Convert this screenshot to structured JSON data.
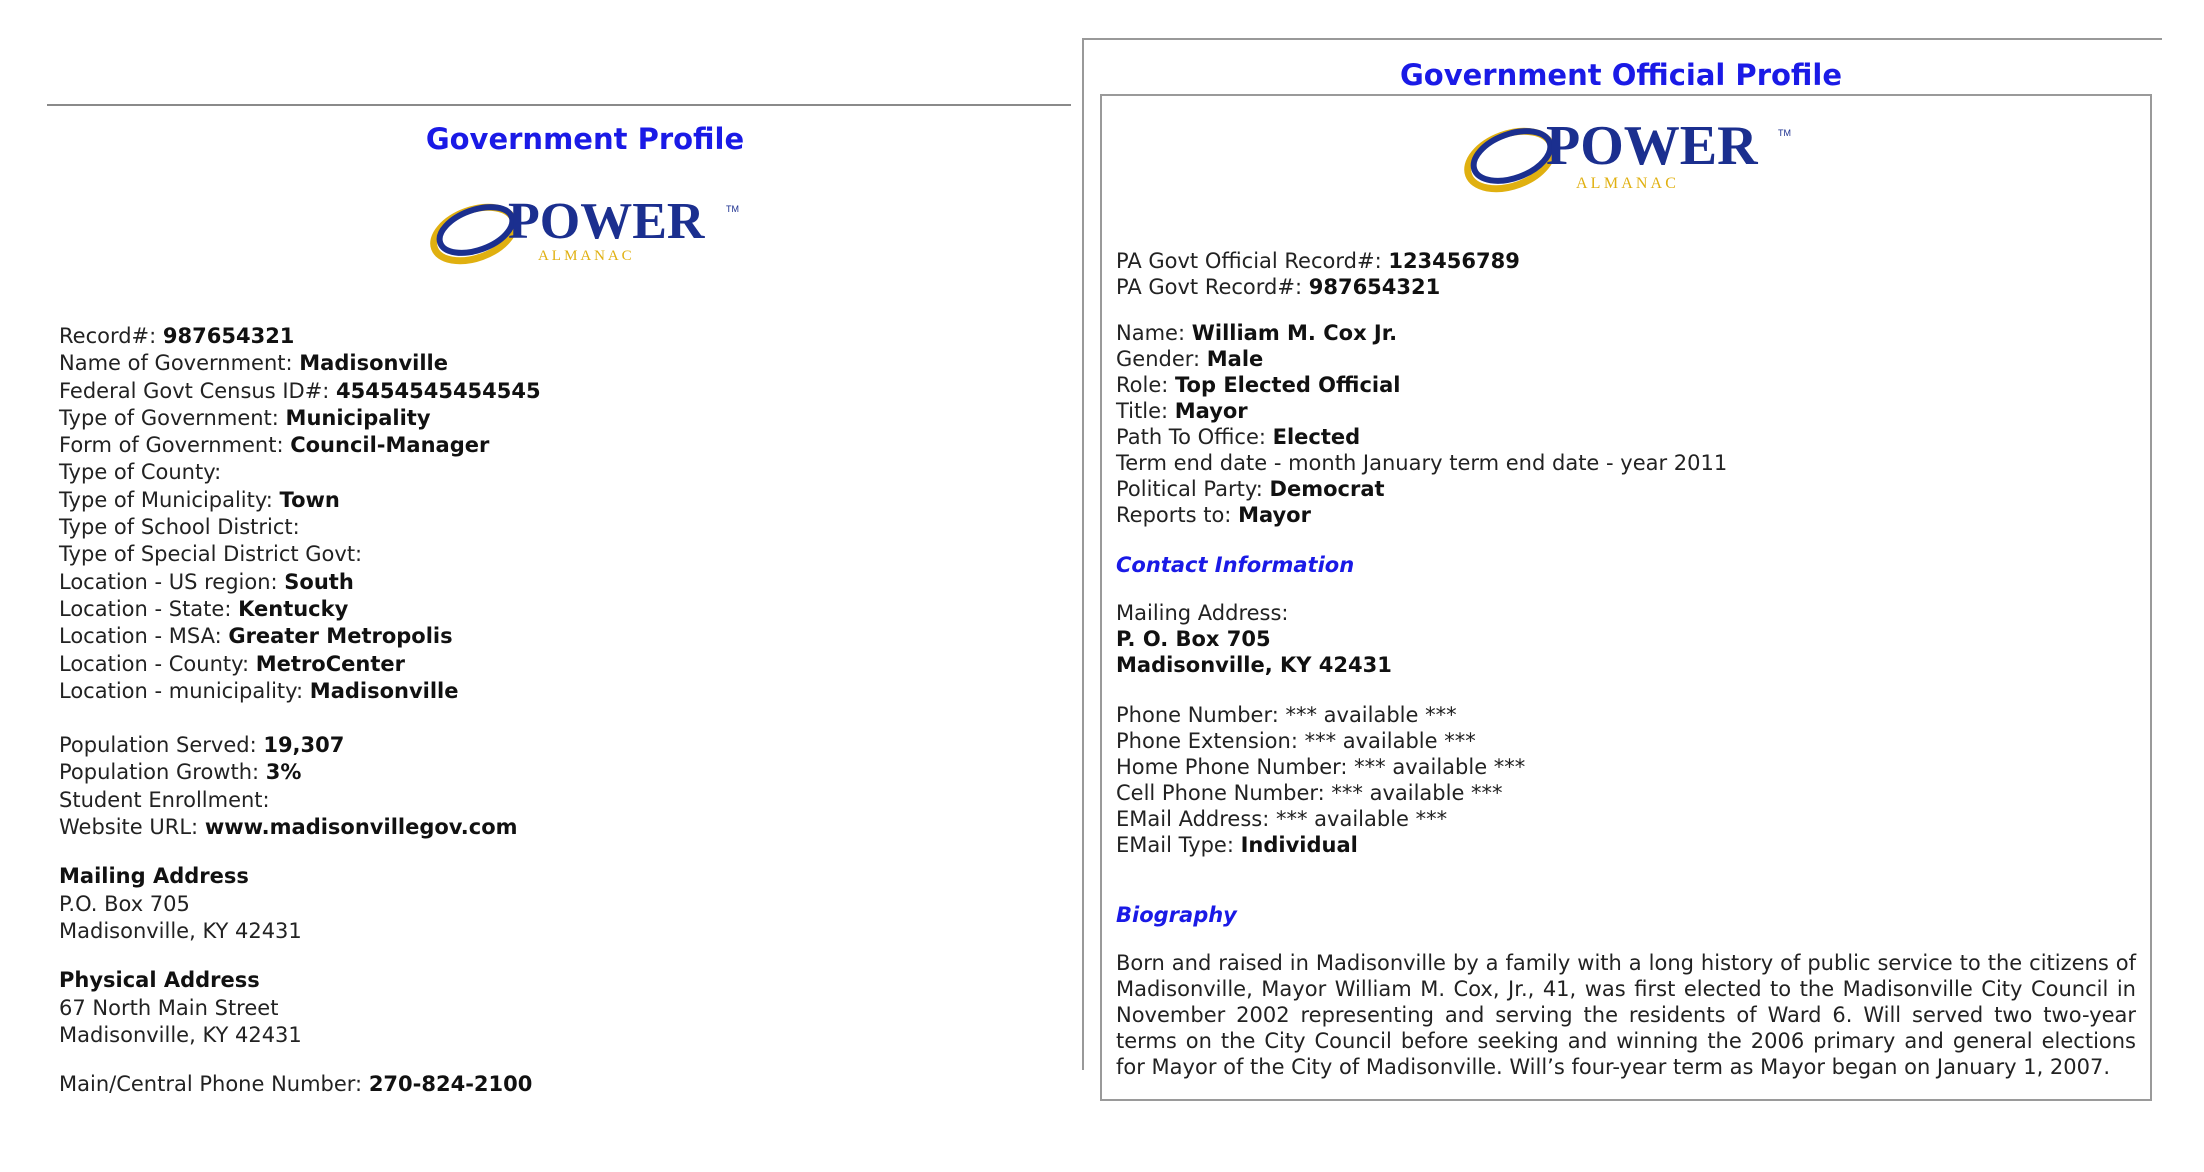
{
  "left": {
    "title": "Government Profile",
    "logo": {
      "word": "POWER",
      "tm": "TM",
      "sub": "A L M A N A C"
    },
    "fields": [
      {
        "label": "Record#: ",
        "value": "987654321"
      },
      {
        "label": "Name of Government: ",
        "value": "Madisonville"
      },
      {
        "label": "Federal Govt Census ID#: ",
        "value": "45454545454545"
      },
      {
        "label": "Type of Government: ",
        "value": "Municipality"
      },
      {
        "label": "Form of Government: ",
        "value": "Council-Manager"
      },
      {
        "label": "Type of County:",
        "value": ""
      },
      {
        "label": "Type of Municipality: ",
        "value": "Town"
      },
      {
        "label": "Type of School District:",
        "value": ""
      },
      {
        "label": "Type of Special District Govt:",
        "value": ""
      },
      {
        "label": "Location - US region: ",
        "value": "South"
      },
      {
        "label": "Location - State: ",
        "value": "Kentucky"
      },
      {
        "label": "Location - MSA: ",
        "value": "Greater Metropolis"
      },
      {
        "label": "Location - County: ",
        "value": "MetroCenter"
      },
      {
        "label": "Location - municipality: ",
        "value": "Madisonville"
      }
    ],
    "fields2": [
      {
        "label": "Population Served: ",
        "value": "19,307"
      },
      {
        "label": "Population Growth: ",
        "value": "3%"
      },
      {
        "label": "Student Enrollment:",
        "value": ""
      },
      {
        "label": "Website URL: ",
        "value": "www.madisonvillegov.com"
      }
    ],
    "mailing": {
      "heading": "Mailing Address",
      "line1": "P.O. Box 705",
      "line2": "Madisonville, KY 42431"
    },
    "physical": {
      "heading": "Physical Address",
      "line1": "67 North Main Street",
      "line2": "Madisonville, KY 42431"
    },
    "phone": {
      "label": "Main/Central Phone Number: ",
      "value": "270-824-2100"
    }
  },
  "right": {
    "title": "Government Official Profile",
    "logo": {
      "word": "POWER",
      "tm": "TM",
      "sub": "A L M A N A C"
    },
    "records": [
      {
        "label": "PA Govt Official Record#: ",
        "value": "123456789"
      },
      {
        "label": "PA Govt Record#: ",
        "value": "987654321"
      }
    ],
    "fields": [
      {
        "label": "Name: ",
        "value": "William M. Cox Jr."
      },
      {
        "label": "Gender: ",
        "value": "Male"
      },
      {
        "label": "Role: ",
        "value": "Top Elected Official"
      },
      {
        "label": "Title: ",
        "value": "Mayor"
      },
      {
        "label": "Path To Office: ",
        "value": "Elected"
      },
      {
        "label": "Term end date - month January term end date - year 2011",
        "value": ""
      },
      {
        "label": "Political Party: ",
        "value": "Democrat"
      },
      {
        "label": "Reports to: ",
        "value": "Mayor"
      }
    ],
    "contact": {
      "heading": "Contact Information",
      "mailing_label": "Mailing Address:",
      "line1": "P. O. Box 705",
      "line2": "Madisonville, KY 42431",
      "items": [
        {
          "label": "Phone Number: ",
          "value": "*** available ***"
        },
        {
          "label": "Phone Extension: ",
          "value": "*** available ***"
        },
        {
          "label": "Home Phone Number: ",
          "value": "*** available ***"
        },
        {
          "label": "Cell Phone Number: ",
          "value": "*** available ***"
        },
        {
          "label": "EMail Address: ",
          "value": "*** available ***"
        }
      ],
      "email_type": {
        "label": "EMail Type: ",
        "value": "Individual"
      }
    },
    "biography": {
      "heading": "Biography",
      "text": "Born and raised in Madisonville by a family with a long history of public service to the citizens of Madisonville, Mayor William M. Cox, Jr., 41, was first elected to the Madisonville City Council in November 2002 representing and serving the residents of Ward 6. Will served two two-year terms on the City Council before seeking and winning the 2006 primary and general elections for Mayor of the City of Madisonville. Will’s four-year term as Mayor began on January 1, 2007."
    }
  },
  "colors": {
    "title_blue": "#1a1ae6",
    "logo_navy": "#1b2f8f",
    "logo_gold": "#e0b010"
  }
}
